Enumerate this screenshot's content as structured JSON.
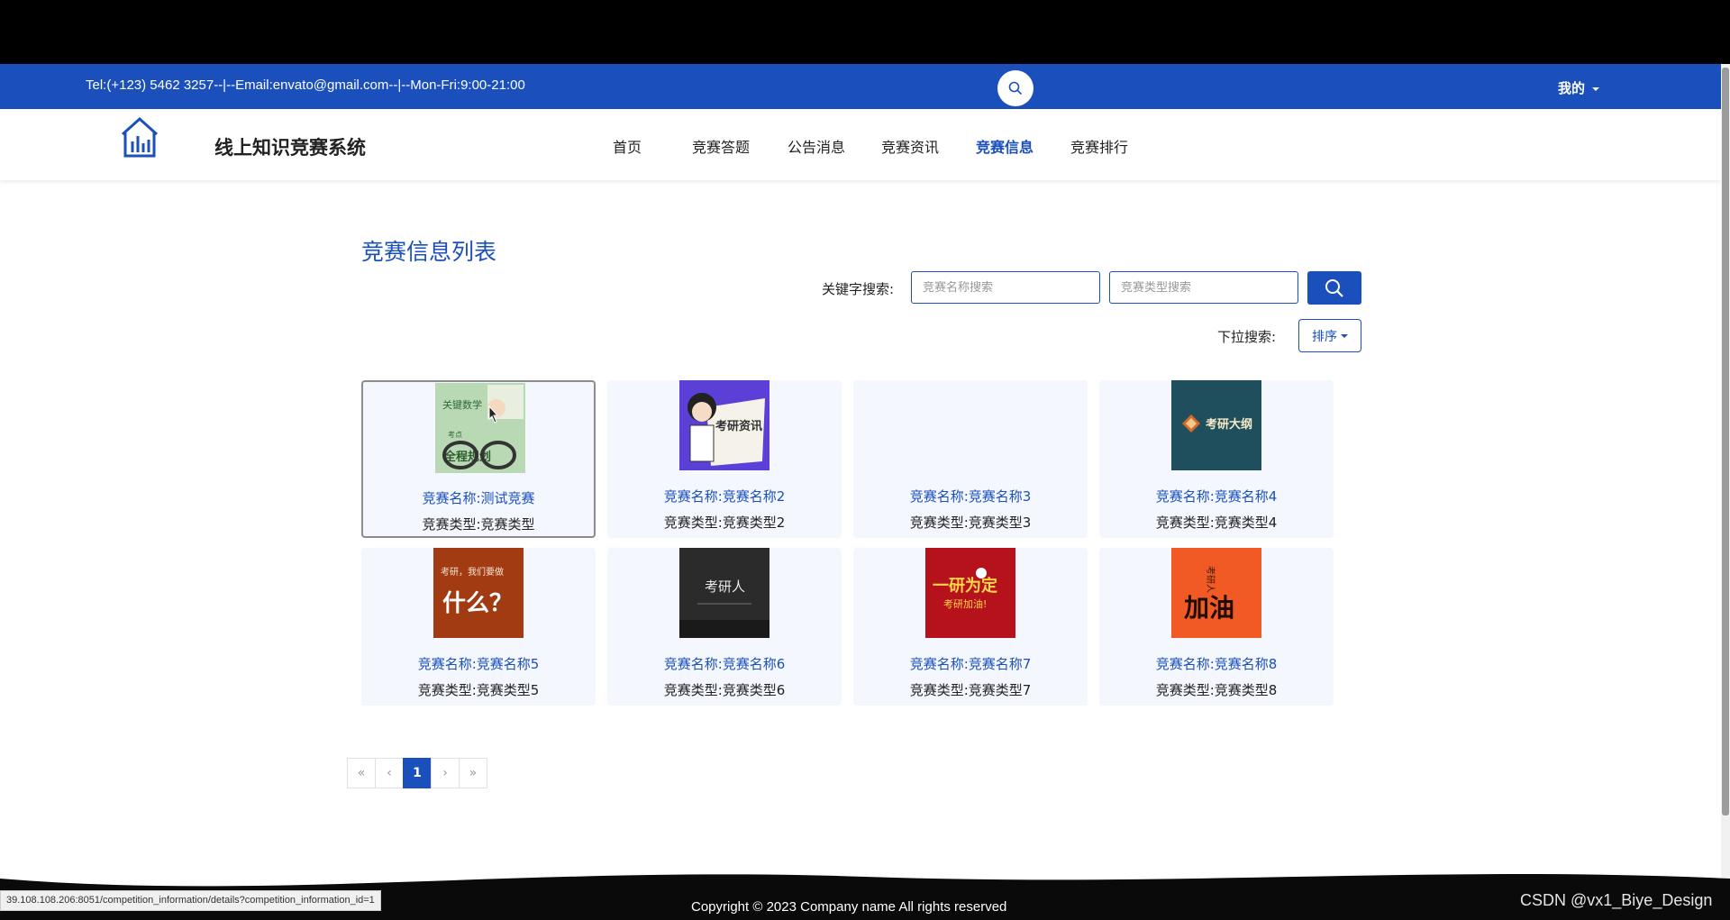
{
  "topbar": {
    "contact": "Tel:(+123) 5462 3257--|--Email:envato@gmail.com--|--Mon-Fri:9:00-21:00",
    "user_menu": "我的"
  },
  "navbar": {
    "site_name": "线上知识竞赛系统",
    "items": [
      {
        "label": "首页"
      },
      {
        "label": "竞赛答题"
      },
      {
        "label": "公告消息"
      },
      {
        "label": "竞赛资讯"
      },
      {
        "label": "竞赛信息",
        "active": true
      },
      {
        "label": "竞赛排行"
      }
    ]
  },
  "main": {
    "title": "竞赛信息列表",
    "keyword_label": "关键字搜索:",
    "name_placeholder": "竞赛名称搜索",
    "type_placeholder": "竞赛类型搜索",
    "dropdown_label": "下拉搜索:",
    "sort_label": "排序"
  },
  "cards": [
    {
      "name": "竞赛名称:测试竞赛",
      "type": "竞赛类型:竞赛类型",
      "image": "study-plan-poster"
    },
    {
      "name": "竞赛名称:竞赛名称2",
      "type": "竞赛类型:竞赛类型2",
      "image": "kaoyan-news-poster"
    },
    {
      "name": "竞赛名称:竞赛名称3",
      "type": "竞赛类型:竞赛类型3",
      "image": ""
    },
    {
      "name": "竞赛名称:竞赛名称4",
      "type": "竞赛类型:竞赛类型4",
      "image": "kaoyan-outline-poster"
    },
    {
      "name": "竞赛名称:竞赛名称5",
      "type": "竞赛类型:竞赛类型5",
      "image": "what-to-do-poster"
    },
    {
      "name": "竞赛名称:竞赛名称6",
      "type": "竞赛类型:竞赛类型6",
      "image": "kaoyan-person-poster"
    },
    {
      "name": "竞赛名称:竞赛名称7",
      "type": "竞赛类型:竞赛类型7",
      "image": "determination-poster"
    },
    {
      "name": "竞赛名称:竞赛名称8",
      "type": "竞赛类型:竞赛类型8",
      "image": "cheer-poster"
    }
  ],
  "pagination": {
    "first": "«",
    "prev": "‹",
    "current": "1",
    "next": "›",
    "last": "»"
  },
  "footer": {
    "copyright": "Copyright © 2023 Company name All rights reserved"
  },
  "status_url": "39.108.108.206:8051/competition_information/details?competition_information_id=1",
  "watermark": "CSDN @vx1_Biye_Design",
  "poster_text": {
    "p1_a": "关键数学",
    "p1_b": "考点",
    "p1_c": "全程规划",
    "p2": "考研资讯",
    "p4": "考研大纲",
    "p5_a": "考研，我们要做",
    "p5_b": "什么？",
    "p6": "考研人",
    "p7_a": "一研为定",
    "p7_b": "考研加油!",
    "p8_a": "考研人",
    "p8_b": "加油"
  },
  "colors": {
    "primary": "#1a4fbc",
    "card_bg": "#f4f7fd"
  }
}
